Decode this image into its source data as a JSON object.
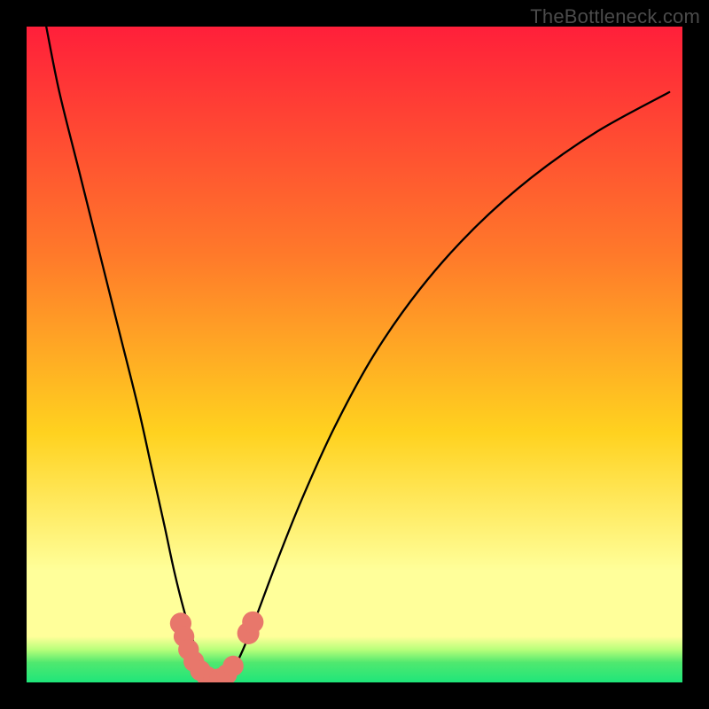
{
  "watermark": "TheBottleneck.com",
  "colors": {
    "top": "#ff1f3a",
    "mid_upper": "#ff7a2a",
    "mid": "#ffd21f",
    "low_band": "#ffff9a",
    "green1": "#b8ff7a",
    "green2": "#4fe86f",
    "green3": "#1fe67a",
    "curve": "#000000",
    "marker": "#e8776b",
    "background": "#000000"
  },
  "chart_data": {
    "type": "line",
    "title": "",
    "xlabel": "",
    "ylabel": "",
    "xlim": [
      0,
      100
    ],
    "ylim": [
      0,
      100
    ],
    "series": [
      {
        "name": "bottleneck-curve",
        "x": [
          3,
          5,
          8,
          11,
          14,
          17,
          19,
          21,
          22.5,
          24,
          25.5,
          27,
          28.5,
          30,
          31.5,
          33,
          35,
          38,
          42,
          47,
          53,
          60,
          68,
          77,
          87,
          98
        ],
        "y": [
          100,
          90,
          78,
          66,
          54,
          42,
          33,
          24,
          17,
          11,
          6,
          2,
          0,
          0,
          2,
          5,
          10,
          18,
          28,
          39,
          50,
          60,
          69,
          77,
          84,
          90
        ]
      }
    ],
    "markers": [
      {
        "x": 23.5,
        "y": 9,
        "r": 1.5
      },
      {
        "x": 24.0,
        "y": 7,
        "r": 1.4
      },
      {
        "x": 24.7,
        "y": 5,
        "r": 1.4
      },
      {
        "x": 25.5,
        "y": 3.2,
        "r": 1.4
      },
      {
        "x": 26.5,
        "y": 1.8,
        "r": 1.4
      },
      {
        "x": 27.5,
        "y": 0.9,
        "r": 1.4
      },
      {
        "x": 28.5,
        "y": 0.5,
        "r": 1.4
      },
      {
        "x": 29.5,
        "y": 0.6,
        "r": 1.4
      },
      {
        "x": 30.5,
        "y": 1.2,
        "r": 1.4
      },
      {
        "x": 31.5,
        "y": 2.5,
        "r": 1.4
      },
      {
        "x": 33.8,
        "y": 7.5,
        "r": 1.6
      },
      {
        "x": 34.5,
        "y": 9.2,
        "r": 1.5
      }
    ]
  }
}
